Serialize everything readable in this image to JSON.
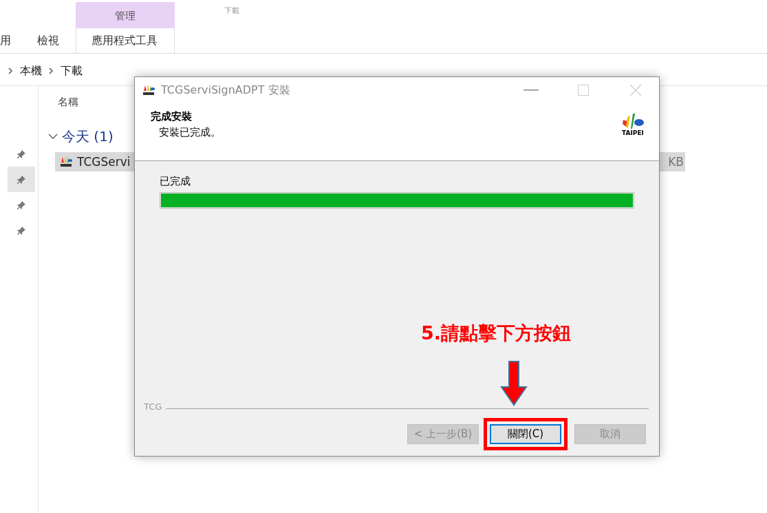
{
  "explorer": {
    "ribbon_context": {
      "group": "管理",
      "window_title": "下載"
    },
    "ribbon_tabs": [
      {
        "label": "用",
        "selected": false
      },
      {
        "label": "檢視",
        "selected": false
      },
      {
        "label": "應用程式工具",
        "selected": true
      }
    ],
    "breadcrumb": [
      "本機",
      "下載"
    ],
    "pins": [
      {
        "selected": false
      },
      {
        "selected": true
      },
      {
        "selected": false
      },
      {
        "selected": false
      }
    ],
    "column_header": "名稱",
    "group": "今天 (1)",
    "file": {
      "name": "TCGServi",
      "size": "KB",
      "selected": true
    }
  },
  "dialog": {
    "title": "TCGServiSignADPT 安裝",
    "heading": "完成安裝",
    "subheading": "安裝已完成。",
    "logo_text": "TAIPEI",
    "status": "已完成",
    "progress": {
      "level": 1
    },
    "footer_label": "TCG",
    "buttons": [
      {
        "label": "< 上一步(B)",
        "disabled": true,
        "default": false,
        "highlighted": false
      },
      {
        "label": "關閉(C)",
        "disabled": false,
        "default": true,
        "highlighted": true
      },
      {
        "label": "取消",
        "disabled": true,
        "default": false,
        "highlighted": false
      }
    ]
  },
  "annotation": {
    "text": "5.請點擊下方按鈕"
  }
}
